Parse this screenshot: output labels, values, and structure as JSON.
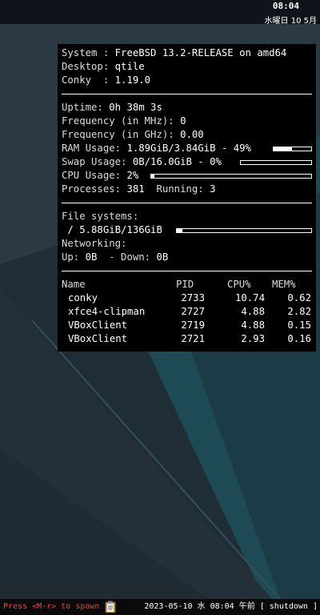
{
  "topbar": {
    "time": "08:04",
    "date": "水曜日 10 5月"
  },
  "conky": {
    "system": {
      "label": "System : ",
      "value": "FreeBSD 13.2-RELEASE on amd64"
    },
    "desktop": {
      "label": "Desktop: ",
      "value": "qtile"
    },
    "conky": {
      "label": "Conky  : ",
      "value": "1.19.0"
    },
    "uptime": {
      "label": "Uptime: ",
      "value": "0h 38m 3s"
    },
    "freq_mhz": {
      "label": "Frequency (in MHz): ",
      "value": "0"
    },
    "freq_ghz": {
      "label": "Frequency (in GHz): ",
      "value": "0.00"
    },
    "ram": {
      "label": "RAM Usage: ",
      "value": "1.89GiB/3.84GiB - 49%",
      "fraction": 0.49
    },
    "swap": {
      "label": "Swap Usage: ",
      "value": "0B/16.0GiB - 0%",
      "fraction": 0.0
    },
    "cpu": {
      "label": "CPU Usage: ",
      "value": "2%",
      "fraction": 0.02
    },
    "processes": {
      "label": "Processes: ",
      "value": "381",
      "running_label": "Running: ",
      "running_value": "3"
    },
    "filesystems": {
      "label": "File systems:",
      "value": " / 5.88GiB/136GiB",
      "fraction": 0.04
    },
    "networking": {
      "label": "Networking:",
      "up_label": "Up: ",
      "up_value": "0B",
      "down_label": "  - Down: ",
      "down_value": "0B"
    },
    "process_table": {
      "headers": {
        "name": "Name",
        "pid": "PID",
        "cpu": "CPU%",
        "mem": "MEM%"
      },
      "rows": [
        {
          "name": "conky",
          "pid": "2733",
          "cpu": "10.74",
          "mem": "0.62"
        },
        {
          "name": "xfce4-clipman",
          "pid": "2727",
          "cpu": "4.88",
          "mem": "2.82"
        },
        {
          "name": "VBoxClient",
          "pid": "2719",
          "cpu": "4.88",
          "mem": "0.15"
        },
        {
          "name": "VBoxClient",
          "pid": "2721",
          "cpu": "2.93",
          "mem": "0.16"
        }
      ]
    }
  },
  "bottombar": {
    "prompt": "Press <M-r> to spawn",
    "clipboard_icon": "clipboard-icon",
    "status": "2023-05-10 水 08:04 午前 [ shutdown ]"
  },
  "colors": {
    "prompt": "#ff3b30",
    "conky_bg": "#000000",
    "text": "#ffffff"
  }
}
